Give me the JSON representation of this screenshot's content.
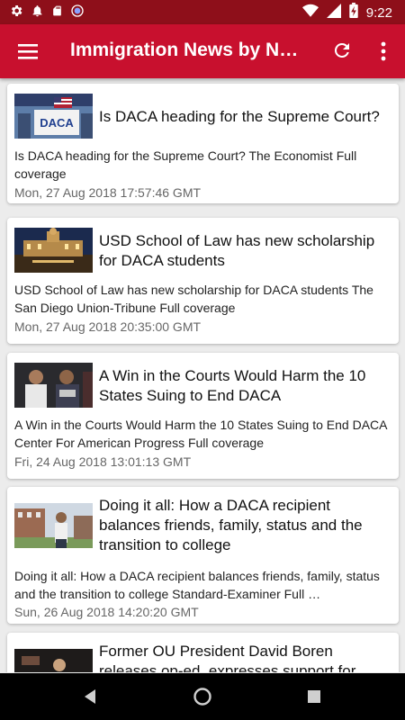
{
  "status_bar": {
    "time": "9:22",
    "icons": [
      "settings-icon",
      "notification-icon",
      "sd-card-icon",
      "sync-icon",
      "wifi-icon",
      "signal-icon",
      "battery-charging-icon"
    ]
  },
  "app_bar": {
    "title": "Immigration News by Ne…",
    "background": "#c8102e",
    "icons": [
      "menu-icon",
      "refresh-icon",
      "more-vert-icon"
    ]
  },
  "articles": [
    {
      "headline": "Is DACA heading for the Supreme Court?",
      "summary": "Is DACA heading for the Supreme Court?  The Economist  Full coverage",
      "date": "Mon, 27 Aug 2018 17:57:46 GMT",
      "thumb_text": "DACA"
    },
    {
      "headline": "USD School of Law has new scholarship for DACA students",
      "summary": "USD School of Law has new scholarship for DACA students  The San Diego Union-Tribune  Full coverage",
      "date": "Mon, 27 Aug 2018 20:35:00 GMT"
    },
    {
      "headline": "A Win in the Courts Would Harm the 10 States Suing to End DACA",
      "summary": "A Win in the Courts Would Harm the 10 States Suing to End DACA  Center For American Progress  Full coverage",
      "date": "Fri, 24 Aug 2018 13:01:13 GMT"
    },
    {
      "headline": "Doing it all: How a DACA recipient balances friends, family, status and the transition to college",
      "summary": "Doing it all: How a DACA recipient balances friends, family, status and the transition to college  Standard-Examiner  Full …",
      "date": "Sun, 26 Aug 2018 14:20:20 GMT"
    },
    {
      "headline": "Former OU President David Boren releases op-ed, expresses support for DACA"
    }
  ]
}
